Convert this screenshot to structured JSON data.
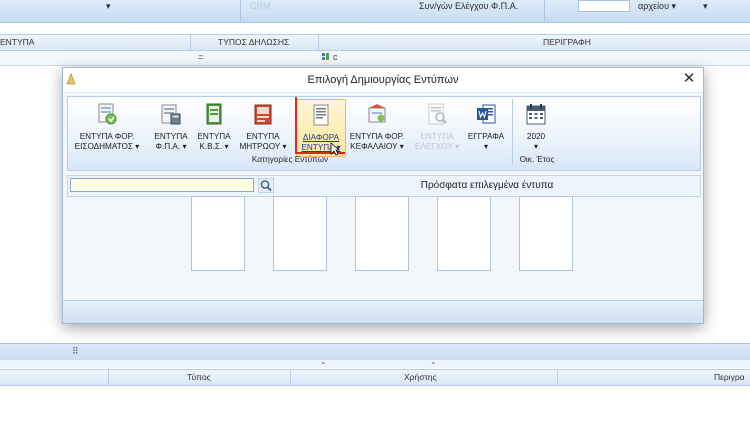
{
  "background": {
    "top_bar": {
      "crm_label": "CRM",
      "vat_check_label": "Συν/γών   Ελέγχου Φ.Π.Α.",
      "file_menu_label": "αρχείου ▾",
      "dropdown_arrow": "▾"
    },
    "grid_headers": {
      "col_forms": "ΕΝΤΥΠΑ",
      "col_declaration_type": "ΤΥΠΟΣ ΔΗΛΩΣΗΣ",
      "col_description": "ΠΕΡΙΓΡΑΦΗ"
    },
    "filter_row": {
      "equals_symbol": "=",
      "contains_label": "c"
    },
    "bottom_grid": {
      "col_type": "Τύπος",
      "col_user": "Χρήστης",
      "col_description": "Περιγρα"
    }
  },
  "dialog": {
    "title": "Επιλογή Δημιουργίας Εντύπων",
    "close_symbol": "✕",
    "ribbon": {
      "buttons": [
        {
          "line1": "ΕΝΤΥΠΑ ΦΟΡ.",
          "line2": "ΕΙΣΟΔΗΜΑΤΟΣ ▾",
          "icon": "tax-income-icon"
        },
        {
          "line1": "ΕΝΤΥΠΑ",
          "line2": "Φ.Π.Α. ▾",
          "icon": "vat-forms-icon"
        },
        {
          "line1": "ΕΝΤΥΠΑ",
          "line2": "Κ.Β.Σ. ▾",
          "icon": "kbs-forms-icon"
        },
        {
          "line1": "ΕΝΤΥΠΑ",
          "line2": "ΜΗΤΡΩΟΥ ▾",
          "icon": "registry-forms-icon"
        },
        {
          "line1": "ΔΙΑΦΟΡΑ",
          "line2": "ΕΝΤΥΠΑ ▾",
          "icon": "misc-forms-icon"
        },
        {
          "line1": "ΕΝΤΥΠΑ ΦΟΡ.",
          "line2": "ΚΕΦΑΛΑΙΟΥ ▾",
          "icon": "capital-tax-icon"
        },
        {
          "line1": "ΕΝΤΥΠΑ",
          "line2": "ΕΛΕΓΧΟΥ ▾",
          "icon": "audit-forms-icon"
        },
        {
          "line1": "ΕΓΓΡΑΦΑ",
          "line2": "▾",
          "icon": "word-document-icon"
        }
      ],
      "year_button": {
        "label": "2020",
        "arrow": "▾"
      },
      "group_categories_label": "Κατηγορίες Εντύπων",
      "group_year_label": "Οικ. Έτος"
    },
    "search": {
      "value": "",
      "placeholder": ""
    },
    "recent_title": "Πρόσφατα επιλεγμένα έντυπα",
    "recent_count_label": ""
  }
}
